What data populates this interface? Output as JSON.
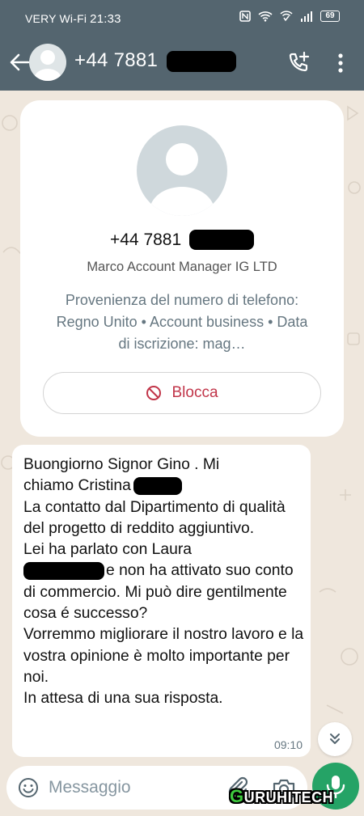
{
  "status_bar": {
    "carrier": "VERY Wi-Fi",
    "time": "21:33",
    "battery": "69"
  },
  "header": {
    "contact_number": "+44 7881"
  },
  "contact_card": {
    "number": "+44 7881",
    "name": "Marco Account Manager IG LTD",
    "info": "Provenienza del numero di telefono: Regno Unito • Account business • Data di iscrizione: mag…",
    "block_label": "Blocca"
  },
  "message": {
    "line1": "Buongiorno Signor Gino . Mi",
    "line2": "chiamo Cristina",
    "line3": "La contatto dal Dipartimento di qualità del progetto di reddito aggiuntivo.",
    "line4a": "Lei ha parlato con Laura",
    "line4b": "e non ha attivato suo conto di commercio. Mi può dire gentilmente cosa é successo?",
    "line5": "Vorremmo migliorare il nostro lavoro e la vostra opinione è molto importante per noi.",
    "line6": "In attesa di una sua risposta.",
    "time": "09:10"
  },
  "composer": {
    "placeholder": "Messaggio"
  },
  "watermark": {
    "text": "URUHITECH"
  },
  "colors": {
    "header_bg": "#54656f",
    "chat_bg": "#efe7dd",
    "block_red": "#c13549",
    "mic_green": "#25a366"
  }
}
